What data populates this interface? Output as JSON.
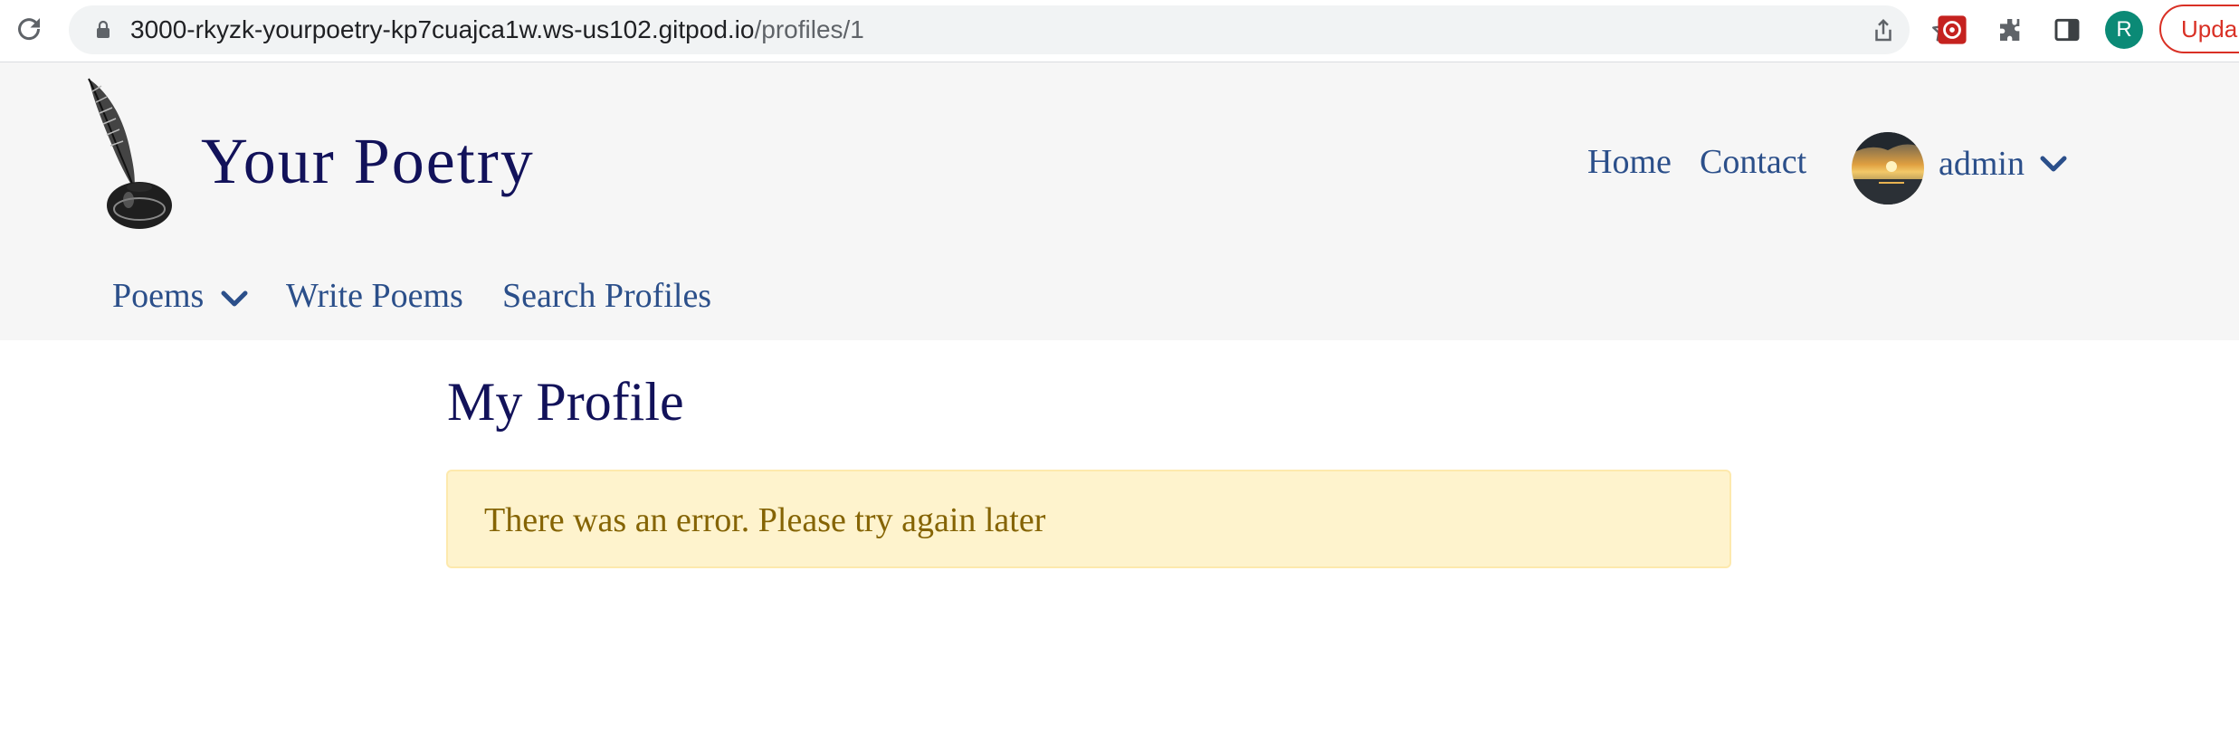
{
  "browser": {
    "url_host": "3000-rkyzk-yourpoetry-kp7cuajca1w.ws-us102.gitpod.io",
    "url_path": "/profiles/1",
    "profile_initial": "R",
    "update_label": "Upda",
    "icons": [
      "reload-icon",
      "lock-icon",
      "share-icon",
      "star-icon",
      "extension-icon",
      "puzzle-icon",
      "side-panel-icon"
    ]
  },
  "header": {
    "brand": "Your Poetry",
    "nav_top": {
      "home": "Home",
      "contact": "Contact"
    },
    "user": {
      "name": "admin"
    },
    "nav_bottom": {
      "poems": "Poems",
      "write": "Write Poems",
      "search": "Search Profiles"
    }
  },
  "main": {
    "title": "My Profile",
    "alert": {
      "text": "There was an error. Please try again later"
    }
  },
  "colors": {
    "brand": "#12125a",
    "link": "#2b4f8a",
    "header_bg": "#f6f6f6",
    "alert_bg": "#fef3cd",
    "alert_text": "#856404",
    "profile_avatar": "#0b8a76",
    "update_red": "#d93025"
  }
}
